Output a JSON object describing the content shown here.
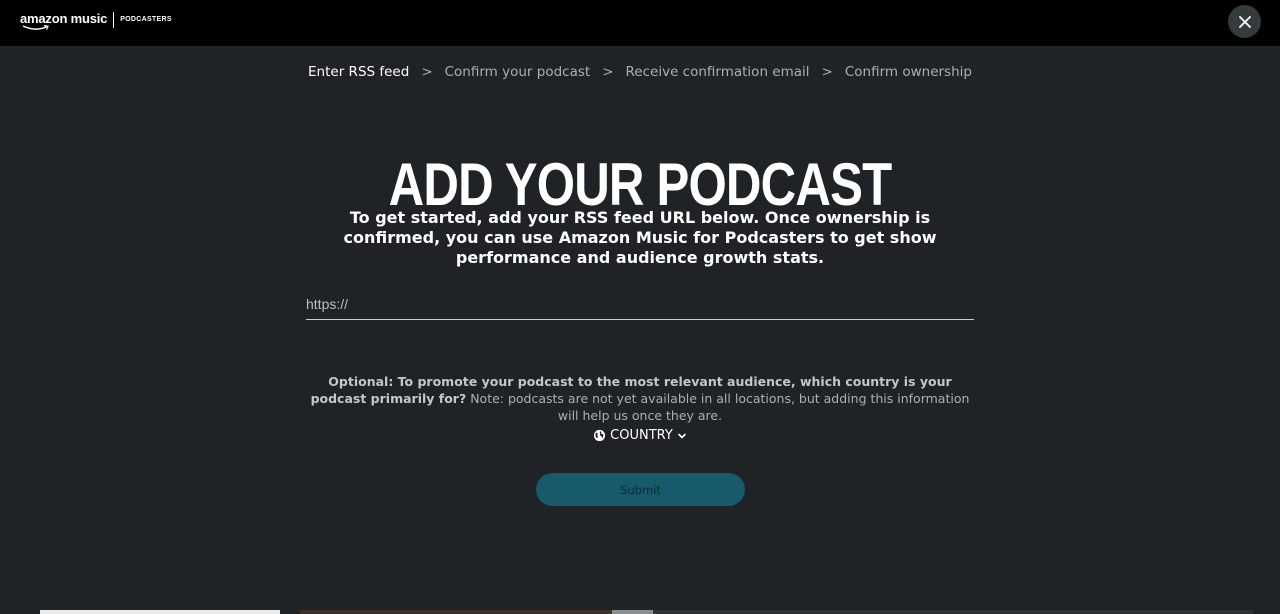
{
  "header": {
    "brand_name": "amazon music",
    "brand_sub": "PODCASTERS",
    "close_icon": "close-icon"
  },
  "breadcrumb": {
    "steps": [
      {
        "label": "Enter RSS feed",
        "active": true
      },
      {
        "label": "Confirm your podcast",
        "active": false
      },
      {
        "label": "Receive confirmation email",
        "active": false
      },
      {
        "label": "Confirm ownership",
        "active": false
      }
    ],
    "separator": ">"
  },
  "main": {
    "title": "ADD YOUR PODCAST",
    "intro": "To get started, add your RSS feed URL below. Once ownership is confirmed, you can use Amazon Music for Podcasters to get show performance and audience growth stats.",
    "rss_input": {
      "value": "",
      "placeholder": "https://"
    },
    "optional_bold": "Optional: To promote your podcast to the most relevant audience, which country is your podcast primarily for?",
    "optional_note": " Note: podcasts are not yet available in all locations, but adding this information will help us once they are.",
    "country_select": {
      "label": "COUNTRY",
      "icon": "globe-icon",
      "chevron": "chevron-down-icon"
    },
    "submit_label": "Submit"
  },
  "colors": {
    "background": "#1f2325",
    "topbar": "#000000",
    "submit_bg": "#165a6b",
    "muted_text": "#a9b0b4"
  }
}
